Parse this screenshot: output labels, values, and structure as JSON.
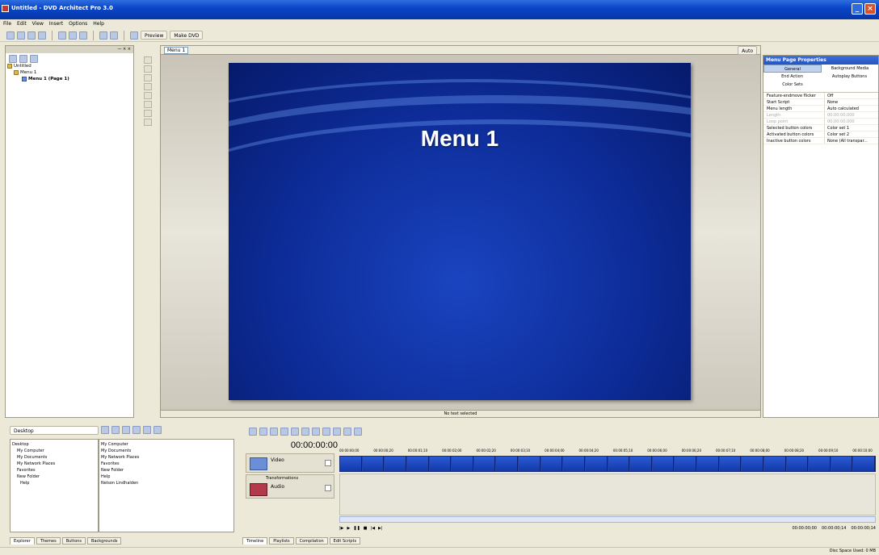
{
  "window": {
    "title": "Untitled - DVD Architect Pro 3.0"
  },
  "menubar": [
    "File",
    "Edit",
    "View",
    "Insert",
    "Options",
    "Help"
  ],
  "toolbar": {
    "preview_label": "Preview",
    "make_dvd_label": "Make DVD",
    "zoom_label": "Auto"
  },
  "project_tree": {
    "items": [
      "Untitled",
      "Menu 1",
      "Menu 1 (Page 1)"
    ]
  },
  "editor": {
    "tab_label": "Menu 1",
    "menu_title": "Menu 1",
    "status": "No text selected"
  },
  "properties": {
    "title": "Menu Page Properties",
    "buttons": [
      [
        "General",
        "Background Media"
      ],
      [
        "End Action",
        "Autoplay Buttons"
      ],
      [
        "Color Sets",
        ""
      ]
    ],
    "rows": [
      [
        "Feature-endmove flicker",
        "Off"
      ],
      [
        "Start Script",
        "None"
      ],
      [
        "Menu length",
        "Auto calculated"
      ],
      [
        "Length",
        "00:00:00.000"
      ],
      [
        "Loop point",
        "00:00:00.000"
      ],
      [
        "Selected button colors",
        "Color set 1"
      ],
      [
        "Activated button colors",
        "Color set 2"
      ],
      [
        "Inactive button colors",
        "None (All transpar..."
      ]
    ]
  },
  "explorer": {
    "address": "Desktop",
    "tree": [
      "Desktop",
      "My Computer",
      "My Documents",
      "My Network Places",
      "Favorites",
      "New Folder",
      "Help"
    ],
    "list": [
      "My Computer",
      "My Documents",
      "My Network Places",
      "Favorites",
      "New Folder",
      "Help",
      "Nelson Lindhalden"
    ],
    "tabs": [
      "Explorer",
      "Themes",
      "Buttons",
      "Backgrounds"
    ]
  },
  "timeline": {
    "timecode": "00:00:00:00",
    "ruler": [
      "00:00:00;00",
      "00:00:00;20",
      "00:00:01;10",
      "00:00:02;00",
      "00:00:02;20",
      "00:00:03;10",
      "00:00:04;00",
      "00:00:04;20",
      "00:00:05;10",
      "00:00:06;00",
      "00:00:06;20",
      "00:00:07;10",
      "00:00:08;00",
      "00:00:08;20",
      "00:00:09;10",
      "00:00:10;00"
    ],
    "video_track": "Video",
    "audio_track": "Audio",
    "audio_group": "Transformations",
    "time_left": "00:00:00;00",
    "time_mid": "00:00:00;14",
    "time_right": "00:00:00;14",
    "tabs": [
      "Timeline",
      "Playlists",
      "Compilation",
      "Edit Scripts"
    ]
  },
  "status_bar": "Disc Space Used: 0 MB"
}
